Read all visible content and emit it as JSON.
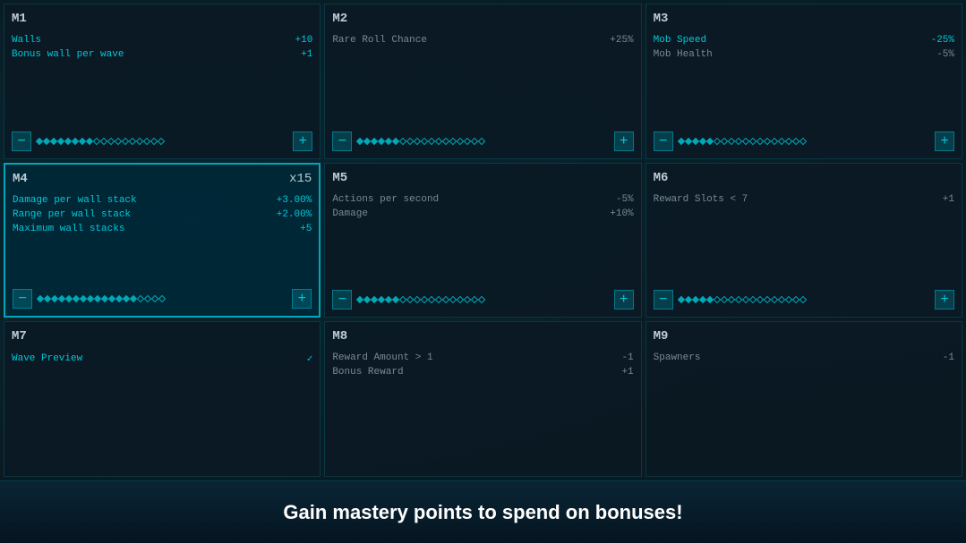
{
  "cards": [
    {
      "id": "m1",
      "title": "M1",
      "multiplier": "",
      "active": false,
      "rows": [
        {
          "label": "Walls",
          "value": "+10",
          "style": "cyan"
        },
        {
          "label": "Bonus wall per wave",
          "value": "+1",
          "style": "cyan"
        }
      ],
      "slider": {
        "filled": 8,
        "total": 18
      }
    },
    {
      "id": "m2",
      "title": "M2",
      "multiplier": "",
      "active": false,
      "rows": [
        {
          "label": "Rare Roll Chance",
          "value": "+25%",
          "style": "dark"
        }
      ],
      "slider": {
        "filled": 6,
        "total": 18
      }
    },
    {
      "id": "m3",
      "title": "M3",
      "multiplier": "",
      "active": false,
      "rows": [
        {
          "label": "Mob Speed",
          "value": "-25%",
          "style": "cyan"
        },
        {
          "label": "Mob Health",
          "value": "-5%",
          "style": "dark"
        }
      ],
      "slider": {
        "filled": 5,
        "total": 18
      }
    },
    {
      "id": "m4",
      "title": "M4",
      "multiplier": "x15",
      "active": true,
      "rows": [
        {
          "label": "Damage per wall stack",
          "value": "+3.00%",
          "style": "cyan"
        },
        {
          "label": "Range per wall stack",
          "value": "+2.00%",
          "style": "cyan"
        },
        {
          "label": "Maximum wall stacks",
          "value": "+5",
          "style": "cyan"
        }
      ],
      "slider": {
        "filled": 14,
        "total": 18
      }
    },
    {
      "id": "m5",
      "title": "M5",
      "multiplier": "",
      "active": false,
      "rows": [
        {
          "label": "Actions per second",
          "value": "-5%",
          "style": "dark"
        },
        {
          "label": "Damage",
          "value": "+10%",
          "style": "dark"
        }
      ],
      "slider": {
        "filled": 6,
        "total": 18
      }
    },
    {
      "id": "m6",
      "title": "M6",
      "multiplier": "",
      "active": false,
      "rows": [
        {
          "label": "Reward Slots < 7",
          "value": "+1",
          "style": "dark"
        }
      ],
      "slider": {
        "filled": 5,
        "total": 18
      }
    },
    {
      "id": "m7",
      "title": "M7",
      "multiplier": "",
      "active": false,
      "rows": [
        {
          "label": "Wave Preview",
          "value": "✓",
          "style": "cyan",
          "check": true
        }
      ],
      "slider": null
    },
    {
      "id": "m8",
      "title": "M8",
      "multiplier": "",
      "active": false,
      "rows": [
        {
          "label": "Reward Amount > 1",
          "value": "-1",
          "style": "dark"
        },
        {
          "label": "Bonus Reward",
          "value": "+1",
          "style": "dark"
        }
      ],
      "slider": null
    },
    {
      "id": "m9",
      "title": "M9",
      "multiplier": "",
      "active": false,
      "rows": [
        {
          "label": "Spawners",
          "value": "-1",
          "style": "dark"
        }
      ],
      "slider": null
    }
  ],
  "bottom_text": "Gain mastery points to spend on bonuses!",
  "minus_label": "−",
  "plus_label": "+"
}
